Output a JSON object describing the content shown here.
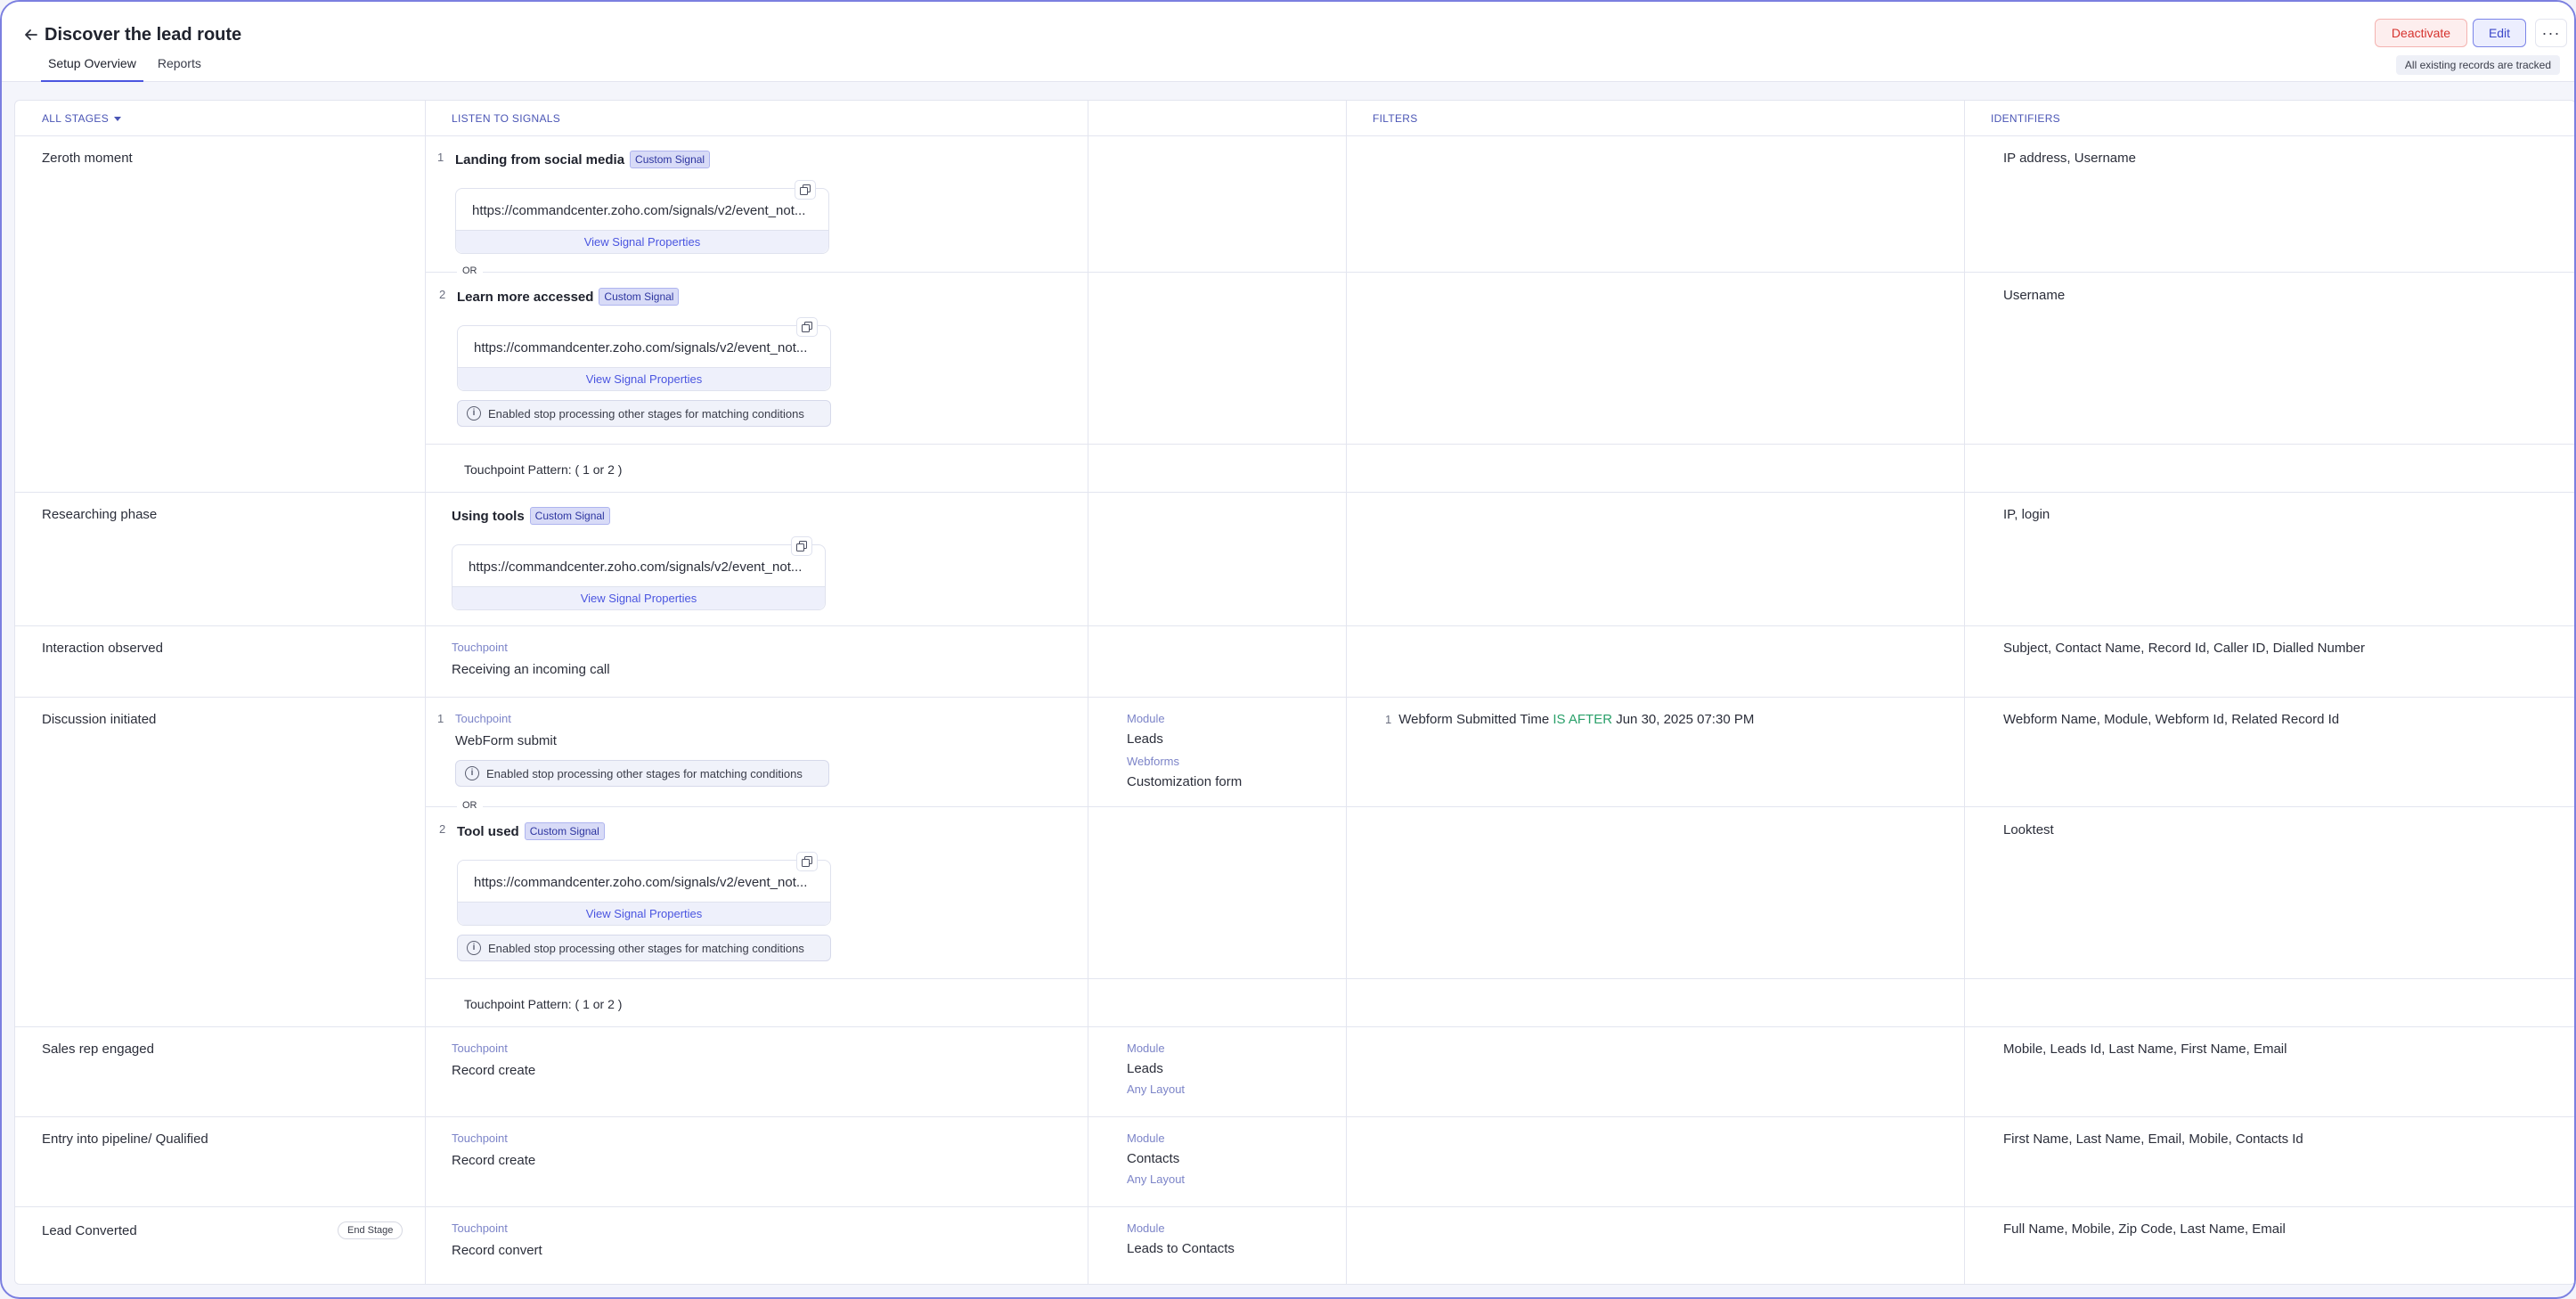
{
  "header": {
    "title": "Discover the lead route",
    "tabs": [
      {
        "label": "Setup Overview",
        "active": true
      },
      {
        "label": "Reports",
        "active": false
      }
    ],
    "deactivate_label": "Deactivate",
    "edit_label": "Edit",
    "more_label": "···",
    "tracked_note": "All existing records are tracked"
  },
  "table": {
    "columns": [
      "ALL STAGES",
      "LISTEN TO SIGNALS",
      "",
      "FILTERS",
      "IDENTIFIERS"
    ],
    "or_label": "OR",
    "view_props_label": "View Signal Properties",
    "custom_signal_tag": "Custom Signal",
    "stop_note": "Enabled stop processing other stages for matching conditions",
    "touchpoint_label": "Touchpoint",
    "module_label": "Module",
    "webforms_label": "Webforms",
    "any_layout": "Any Layout",
    "end_stage_label": "End Stage",
    "pattern_text": "Touchpoint Pattern: ( 1 or 2 )",
    "url_text": "https://commandcenter.zoho.com/signals/v2/event_not...",
    "rows": {
      "zeroth": {
        "stage": "Zeroth moment",
        "sig1_num": "1",
        "sig1_name": "Landing from social media",
        "sig1_ident": "IP address, Username",
        "sig2_num": "2",
        "sig2_name": "Learn more accessed",
        "sig2_ident": "Username"
      },
      "research": {
        "stage": "Researching phase",
        "sig_name": "Using tools",
        "ident": "IP, login"
      },
      "interaction": {
        "stage": "Interaction observed",
        "tp_value": "Receiving an incoming call",
        "ident": "Subject, Contact Name, Record Id, Caller ID, Dialled Number"
      },
      "discussion": {
        "stage": "Discussion initiated",
        "sig1_num": "1",
        "tp_value": "WebForm submit",
        "module_value": "Leads",
        "webform_value": "Customization form",
        "filter_num": "1",
        "filter_field": "Webform Submitted Time",
        "filter_op": "IS AFTER",
        "filter_value": "Jun 30, 2025 07:30 PM",
        "ident1": "Webform Name, Module, Webform Id, Related Record Id",
        "sig2_num": "2",
        "sig2_name": "Tool used",
        "ident2": "Looktest"
      },
      "salesrep": {
        "stage": "Sales rep engaged",
        "tp_value": "Record create",
        "module_value": "Leads",
        "ident": "Mobile, Leads Id, Last Name, First Name, Email"
      },
      "pipeline": {
        "stage": "Entry into pipeline/ Qualified",
        "tp_value": "Record create",
        "module_value": "Contacts",
        "ident": "First Name, Last Name, Email, Mobile, Contacts Id"
      },
      "converted": {
        "stage": "Lead Converted",
        "tp_value": "Record convert",
        "module_value": "Leads to Contacts",
        "ident": "Full Name, Mobile, Zip Code, Last Name, Email"
      }
    }
  }
}
